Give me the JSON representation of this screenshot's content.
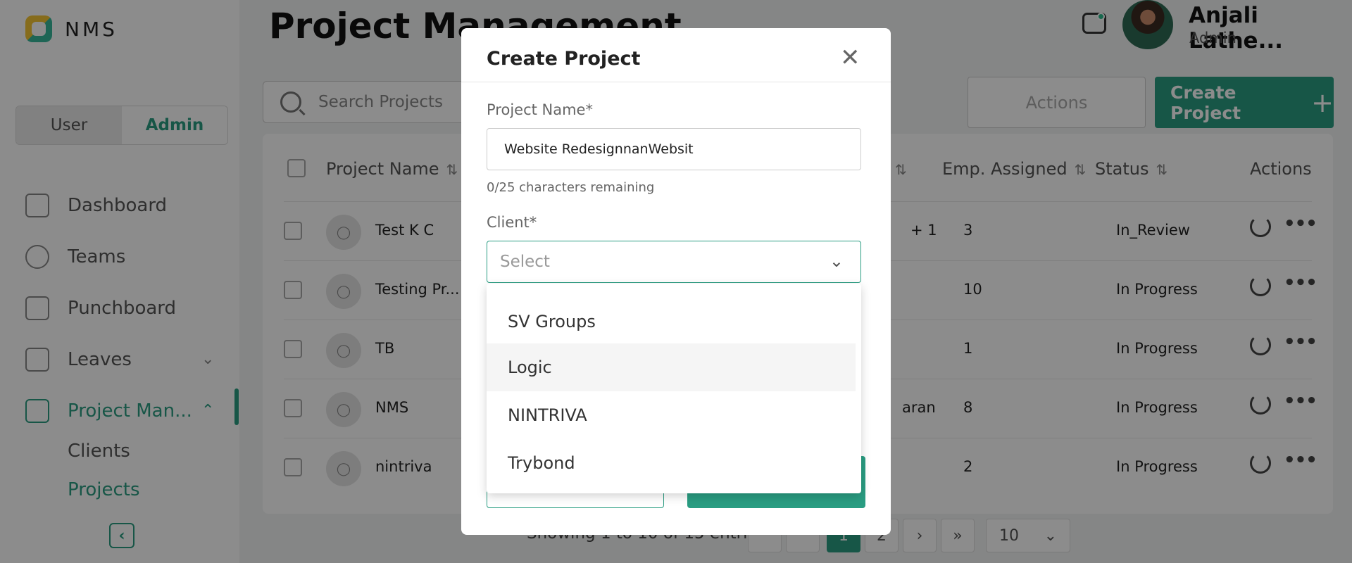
{
  "brand": {
    "name": "NMS"
  },
  "sidebar": {
    "role_options": [
      "User",
      "Admin"
    ],
    "active_role": "Admin",
    "items": [
      {
        "label": "Dashboard",
        "icon": "dashboard-icon"
      },
      {
        "label": "Teams",
        "icon": "teams-icon"
      },
      {
        "label": "Punchboard",
        "icon": "punchboard-icon"
      },
      {
        "label": "Leaves",
        "icon": "calendar-icon",
        "expandable": true
      },
      {
        "label": "Project Man...",
        "icon": "briefcase-icon",
        "expandable": true,
        "active": true
      }
    ],
    "sub_items": [
      {
        "label": "Clients"
      },
      {
        "label": "Projects",
        "active": true
      }
    ]
  },
  "header": {
    "title": "Project Management",
    "user_name": "Anjali Lathe...",
    "user_role": "Admin"
  },
  "toolbar": {
    "search_placeholder": "Search Projects",
    "actions_label": "Actions",
    "create_label": "Create Project"
  },
  "table": {
    "columns": [
      "Project Name",
      "Emp. Assigned",
      "Status",
      "Actions"
    ],
    "rows": [
      {
        "name": "Test K C",
        "extra": "+ 1",
        "emp": "3",
        "status": "In_Review"
      },
      {
        "name": "Testing Pr...",
        "extra": "",
        "emp": "10",
        "status": "In Progress"
      },
      {
        "name": "TB",
        "extra": "",
        "emp": "1",
        "status": "In Progress"
      },
      {
        "name": "NMS",
        "extra": "aran",
        "emp": "8",
        "status": "In Progress"
      },
      {
        "name": "nintriva",
        "extra": "",
        "emp": "2",
        "status": "In Progress"
      }
    ]
  },
  "pagination": {
    "summary": "Showing 1 to 10 of 15 entries",
    "pages": [
      "1",
      "2"
    ],
    "active_page": "1",
    "next": "›",
    "last": "»",
    "page_size": "10"
  },
  "modal": {
    "title": "Create Project",
    "project_name_label": "Project Name*",
    "project_name_value": "Website RedesignnanWebsit",
    "chars_hint": "0/25 characters remaining",
    "client_label": "Client*",
    "client_placeholder": "Select",
    "client_options": [
      "SV Groups",
      "Logic",
      "NINTRIVA",
      "Trybond"
    ],
    "hovered_option": "Logic"
  },
  "colors": {
    "accent": "#2a9d82",
    "overlay": "rgba(0,0,0,0.45)"
  }
}
